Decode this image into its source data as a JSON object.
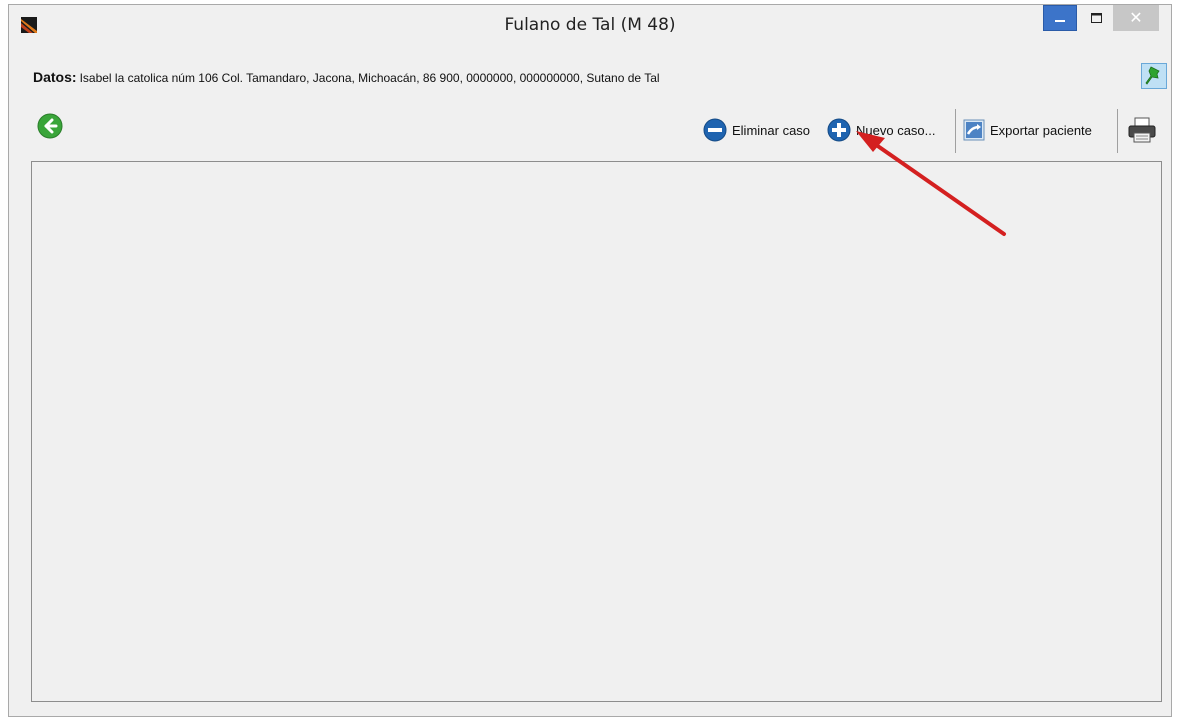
{
  "window": {
    "title": "Fulano de Tal (M 48)",
    "close_glyph": "✕"
  },
  "info": {
    "label": "Datos:",
    "value": "Isabel la catolica núm 106 Col. Tamandaro, Jacona, Michoacán, 86 900, 0000000, 000000000, Sutano de Tal"
  },
  "toolbar": {
    "delete_label": "Eliminar caso",
    "new_label": "Nuevo caso...",
    "export_label": "Exportar paciente"
  },
  "icons": {
    "app": "app-logo-icon",
    "back": "back-arrow-icon",
    "delete": "minus-circle-icon",
    "new": "plus-circle-icon",
    "export": "export-icon",
    "print": "printer-icon",
    "pin": "pushpin-icon"
  },
  "colors": {
    "accent_blue": "#3c74c9",
    "back_green": "#3aa53a",
    "annotation_red": "#d42020"
  }
}
